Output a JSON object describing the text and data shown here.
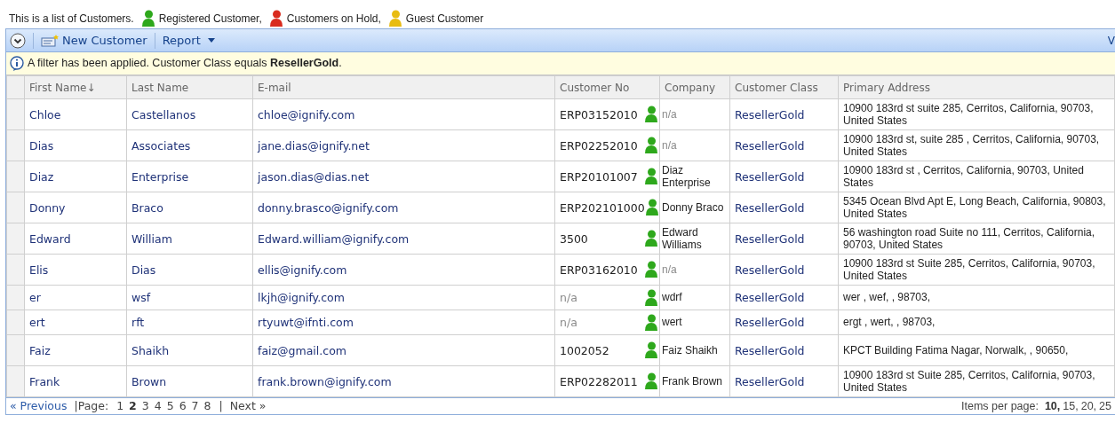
{
  "intro": {
    "text": "This is a list of Customers.",
    "legend": [
      {
        "label": "Registered Customer,",
        "color": "#2ea81c"
      },
      {
        "label": "Customers on Hold,",
        "color": "#d92b1e"
      },
      {
        "label": "Guest Customer",
        "color": "#e8bc12"
      }
    ]
  },
  "toolbar": {
    "buttons": [
      {
        "label": "New Customer",
        "kind": "new"
      },
      {
        "label": "Report",
        "kind": "menu"
      }
    ],
    "right_text": "V"
  },
  "filter": {
    "text": "A filter has been applied. Customer Class equals **ResellerGold**."
  },
  "table": {
    "columns": [
      "First Name↓",
      "Last Name",
      "E-mail",
      "Customer No",
      "Company",
      "Customer Class",
      "Primary Address"
    ],
    "rows": [
      {
        "first_name": "Chloe",
        "last_name": "Castellanos",
        "email": "chloe@ignify.com",
        "customer_no": "ERP03152010",
        "customer_no_missing": false,
        "color": "#2ea81c",
        "company": "n/a",
        "company_missing": true,
        "customer_class": "ResellerGold",
        "address": "10900 183rd st suite 285, Cerritos, California, 90703, United States"
      },
      {
        "first_name": "Dias",
        "last_name": "Associates",
        "email": "jane.dias@ignify.net",
        "customer_no": "ERP02252010",
        "customer_no_missing": false,
        "color": "#2ea81c",
        "company": "n/a",
        "company_missing": true,
        "customer_class": "ResellerGold",
        "address": "10900 183rd st, suite 285 , Cerritos, California, 90703, United States"
      },
      {
        "first_name": "Diaz",
        "last_name": "Enterprise",
        "email": "jason.dias@dias.net",
        "customer_no": "ERP20101007",
        "customer_no_missing": false,
        "color": "#2ea81c",
        "company": "Diaz Enterprise",
        "company_missing": false,
        "customer_class": "ResellerGold",
        "address": "10900 183rd st , Cerritos, California, 90703, United States"
      },
      {
        "first_name": "Donny",
        "last_name": "Braco",
        "email": "donny.brasco@ignify.com",
        "customer_no": "ERP202101000",
        "customer_no_missing": false,
        "color": "#2ea81c",
        "company": "Donny Braco",
        "company_missing": false,
        "customer_class": "ResellerGold",
        "address": "5345 Ocean Blvd Apt E, Long Beach, California, 90803, United States"
      },
      {
        "first_name": "Edward",
        "last_name": "William",
        "email": "Edward.william@ignify.com",
        "customer_no": "3500",
        "customer_no_missing": false,
        "color": "#2ea81c",
        "company": "Edward Williams",
        "company_missing": false,
        "customer_class": "ResellerGold",
        "address": "56 washington road Suite no 111, Cerritos, California, 90703, United States"
      },
      {
        "first_name": "Elis",
        "last_name": "Dias",
        "email": "ellis@ignify.com",
        "customer_no": "ERP03162010",
        "customer_no_missing": false,
        "color": "#2ea81c",
        "company": "n/a",
        "company_missing": true,
        "customer_class": "ResellerGold",
        "address": "10900 183rd st Suite 285, Cerritos, California, 90703, United States"
      },
      {
        "first_name": "er",
        "last_name": "wsf",
        "email": "lkjh@ignify.com",
        "customer_no": "n/a",
        "customer_no_missing": true,
        "color": "#2ea81c",
        "company": "wdrf",
        "company_missing": false,
        "customer_class": "ResellerGold",
        "address": "wer , wef, , 98703,"
      },
      {
        "first_name": "ert",
        "last_name": "rft",
        "email": "rtyuwt@ifnti.com",
        "customer_no": "n/a",
        "customer_no_missing": true,
        "color": "#2ea81c",
        "company": "wert",
        "company_missing": false,
        "customer_class": "ResellerGold",
        "address": "ergt , wert, , 98703,"
      },
      {
        "first_name": "Faiz",
        "last_name": "Shaikh",
        "email": "faiz@gmail.com",
        "customer_no": "1002052",
        "customer_no_missing": false,
        "color": "#2ea81c",
        "company": "Faiz Shaikh",
        "company_missing": false,
        "customer_class": "ResellerGold",
        "address": "KPCT Building Fatima Nagar, Norwalk, , 90650,"
      },
      {
        "first_name": "Frank",
        "last_name": "Brown",
        "email": "frank.brown@ignify.com",
        "customer_no": "ERP02282011",
        "customer_no_missing": false,
        "color": "#2ea81c",
        "company": "Frank Brown",
        "company_missing": false,
        "customer_class": "ResellerGold",
        "address": "10900 183rd st Suite 285, Cerritos, California, 90703, United States"
      }
    ]
  },
  "pager": {
    "previous": "« Previous",
    "page_label": "|Page:",
    "pages": [
      {
        "label": "1",
        "selected": false
      },
      {
        "label": "2",
        "selected": true
      },
      {
        "label": "3",
        "selected": false
      },
      {
        "label": "4",
        "selected": false
      },
      {
        "label": "5",
        "selected": false
      },
      {
        "label": "6",
        "selected": false
      },
      {
        "label": "7",
        "selected": false
      },
      {
        "label": "8",
        "selected": false
      }
    ],
    "separator": "|",
    "next": "Next »",
    "items_label": "Items per page:",
    "sizes": [
      {
        "label": "10,",
        "selected": true
      },
      {
        "label": "15,",
        "selected": false
      },
      {
        "label": "20,",
        "selected": false
      },
      {
        "label": "25",
        "selected": false
      }
    ]
  }
}
